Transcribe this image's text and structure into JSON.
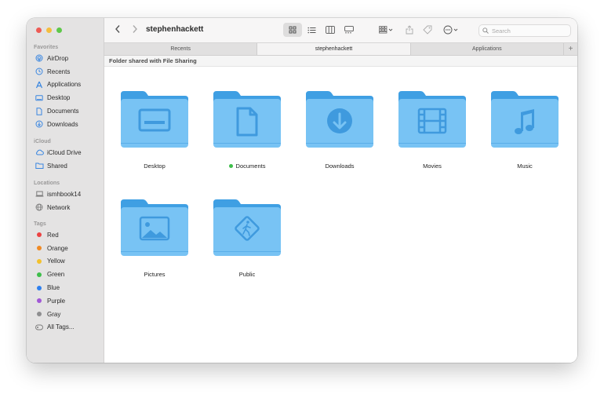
{
  "window": {
    "title": "stephenhackett",
    "search_placeholder": "Search"
  },
  "sidebar": {
    "favorites_heading": "Favorites",
    "favorites": [
      {
        "label": "AirDrop",
        "icon": "airdrop-icon"
      },
      {
        "label": "Recents",
        "icon": "clock-icon"
      },
      {
        "label": "Applications",
        "icon": "applications-icon"
      },
      {
        "label": "Desktop",
        "icon": "desktop-icon"
      },
      {
        "label": "Documents",
        "icon": "document-icon"
      },
      {
        "label": "Downloads",
        "icon": "download-icon"
      }
    ],
    "icloud_heading": "iCloud",
    "icloud": [
      {
        "label": "iCloud Drive",
        "icon": "cloud-icon"
      },
      {
        "label": "Shared",
        "icon": "shared-folder-icon"
      }
    ],
    "locations_heading": "Locations",
    "locations": [
      {
        "label": "ismhbook14",
        "icon": "laptop-icon"
      },
      {
        "label": "Network",
        "icon": "globe-icon"
      }
    ],
    "tags_heading": "Tags",
    "tags": [
      {
        "label": "Red",
        "color": "#ec4242"
      },
      {
        "label": "Orange",
        "color": "#f08a24"
      },
      {
        "label": "Yellow",
        "color": "#f3c12c"
      },
      {
        "label": "Green",
        "color": "#3ebe4a"
      },
      {
        "label": "Blue",
        "color": "#2e80ef"
      },
      {
        "label": "Purple",
        "color": "#a158d6"
      },
      {
        "label": "Gray",
        "color": "#8e8e90"
      }
    ],
    "all_tags": "All Tags..."
  },
  "tabs": [
    {
      "label": "Recents",
      "active": false
    },
    {
      "label": "stephenhackett",
      "active": true
    },
    {
      "label": "Applications",
      "active": false
    }
  ],
  "infobar": {
    "text": "Folder shared with File Sharing"
  },
  "folders": [
    {
      "label": "Desktop",
      "glyph": "desktop-glyph-icon"
    },
    {
      "label": "Documents",
      "glyph": "document-glyph-icon",
      "tag_color": "#3ebe4a"
    },
    {
      "label": "Downloads",
      "glyph": "download-glyph-icon"
    },
    {
      "label": "Movies",
      "glyph": "film-glyph-icon"
    },
    {
      "label": "Music",
      "glyph": "music-note-glyph-icon"
    },
    {
      "label": "Pictures",
      "glyph": "picture-glyph-icon"
    },
    {
      "label": "Public",
      "glyph": "public-glyph-icon"
    }
  ],
  "colors": {
    "folder_body": "#78c3f4",
    "folder_tab": "#4ba6e6",
    "folder_glyph": "#3f9ade",
    "sidebar_icon": "#3a86e0"
  }
}
